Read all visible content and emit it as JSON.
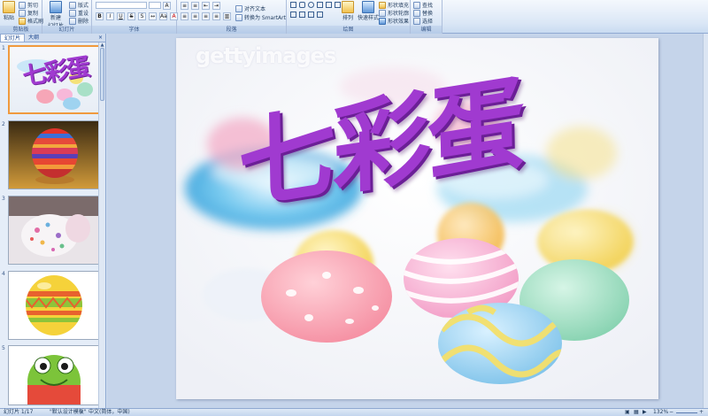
{
  "ribbon": {
    "clipboard": {
      "paste": "粘贴",
      "cut": "剪切",
      "copy": "复制",
      "format_painter": "格式刷",
      "label": "剪贴板"
    },
    "slides": {
      "new_slide": "新建",
      "new_slide_2": "幻灯片",
      "layout": "版式",
      "reset": "重设",
      "delete": "删除",
      "label": "幻灯片"
    },
    "font": {
      "label": "字体"
    },
    "paragraph": {
      "align_text": "对齐文本",
      "convert_smartart": "转换为 SmartArt",
      "label": "段落"
    },
    "drawing": {
      "arrange": "排列",
      "quick_styles": "快速样式",
      "shape_fill": "形状填充",
      "shape_outline": "形状轮廓",
      "shape_effects": "形状效果",
      "label": "绘图"
    },
    "editing": {
      "find": "查找",
      "replace": "替换",
      "select": "选择",
      "label": "编辑"
    }
  },
  "pane": {
    "tabs": [
      {
        "label": "幻灯片"
      },
      {
        "label": "大纲"
      }
    ],
    "close": "×",
    "thumbs": [
      {
        "num": "1"
      },
      {
        "num": "2"
      },
      {
        "num": "3"
      },
      {
        "num": "4"
      },
      {
        "num": "5"
      }
    ]
  },
  "slide": {
    "watermark": "gettyimages",
    "title": "七彩蛋",
    "thumb_title": "七彩蛋"
  },
  "status": {
    "slide_info": "幻灯片 1/17",
    "theme": "\"默认设计模板\"",
    "language": "中文(简体，中国)",
    "zoom": "132%"
  },
  "colors": {
    "accent": "#a03ad0",
    "selected_border": "#f09a3e"
  }
}
